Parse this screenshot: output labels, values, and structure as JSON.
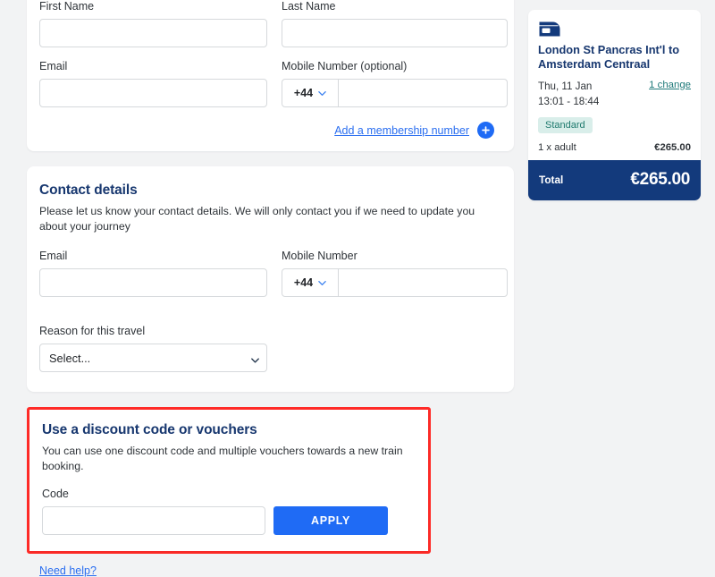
{
  "passenger": {
    "first_name": {
      "label": "First Name",
      "value": "",
      "placeholder": ""
    },
    "last_name": {
      "label": "Last Name",
      "value": "",
      "placeholder": ""
    },
    "email": {
      "label": "Email",
      "value": "",
      "placeholder": ""
    },
    "mobile": {
      "label": "Mobile Number (optional)",
      "prefix": "+44",
      "value": "",
      "placeholder": ""
    },
    "membership_link": "Add a membership number",
    "add_icon": "plus-icon"
  },
  "contact": {
    "title": "Contact details",
    "subtitle": "Please let us know your contact details. We will only contact you if we need to update you about your journey",
    "email": {
      "label": "Email",
      "value": "",
      "placeholder": ""
    },
    "mobile": {
      "label": "Mobile Number",
      "prefix": "+44",
      "value": "",
      "placeholder": ""
    },
    "reason": {
      "label": "Reason for this travel",
      "selected": "Select...",
      "chevron_icon": "chevron-down-icon"
    }
  },
  "discount": {
    "title": "Use a discount code or vouchers",
    "subtitle": "You can use one discount code and multiple vouchers towards a new train booking.",
    "code": {
      "label": "Code",
      "value": "",
      "placeholder": ""
    },
    "apply_label": "APPLY",
    "highlight_color": "#ff2b27"
  },
  "need_help": "Need help?",
  "summary": {
    "train_icon": "train-icon",
    "route": "London St Pancras Int'l to Amsterdam Centraal",
    "date": "Thu, 11 Jan",
    "time": "13:01 - 18:44",
    "change_link": "1 change",
    "class_badge": "Standard",
    "passengers_label": "1 x adult",
    "passengers_price": "€265.00",
    "total_label": "Total",
    "total_amount": "€265.00",
    "brand_navy": "#133a7c",
    "badge_bg": "#d9eeea",
    "badge_fg": "#1f7a6e"
  }
}
